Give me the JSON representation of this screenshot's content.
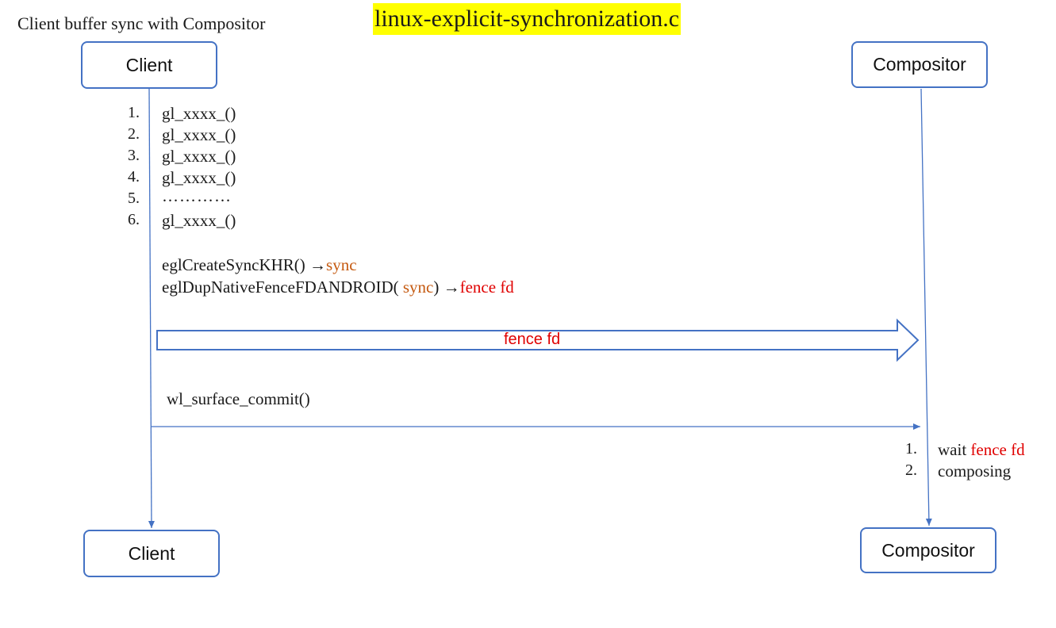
{
  "diagram_title": "Client buffer sync with Compositor",
  "file_title": "linux-explicit-synchronization.c",
  "client_top": "Client",
  "compositor_top": "Compositor",
  "client_bottom": "Client",
  "compositor_bottom": "Compositor",
  "client_steps": [
    {
      "num": "1.",
      "text": "gl_xxxx_()"
    },
    {
      "num": "2.",
      "text": "gl_xxxx_()"
    },
    {
      "num": "3.",
      "text": "gl_xxxx_()"
    },
    {
      "num": "4.",
      "text": "gl_xxxx_()"
    },
    {
      "num": "5.",
      "text": "…………"
    },
    {
      "num": "6.",
      "text": "gl_xxxx_()"
    }
  ],
  "sync_call": {
    "fn": "eglCreateSyncKHR()",
    "arrow": "→",
    "result": "sync"
  },
  "fence_call": {
    "fn_open": "eglDupNativeFenceFDANDROID(",
    "arg": "sync",
    "fn_close": ")",
    "arrow": "→",
    "result": "fence fd"
  },
  "fence_arrow_label": "fence fd",
  "commit_label": "wl_surface_commit()",
  "compositor_steps": [
    {
      "num": "1.",
      "prefix": "wait ",
      "highlight": "fence fd"
    },
    {
      "num": "2.",
      "prefix": "composing",
      "highlight": ""
    }
  ],
  "colors": {
    "line": "#4472c4",
    "sync": "#c55a11",
    "fence": "#e00000",
    "highlight": "#ffff00"
  }
}
